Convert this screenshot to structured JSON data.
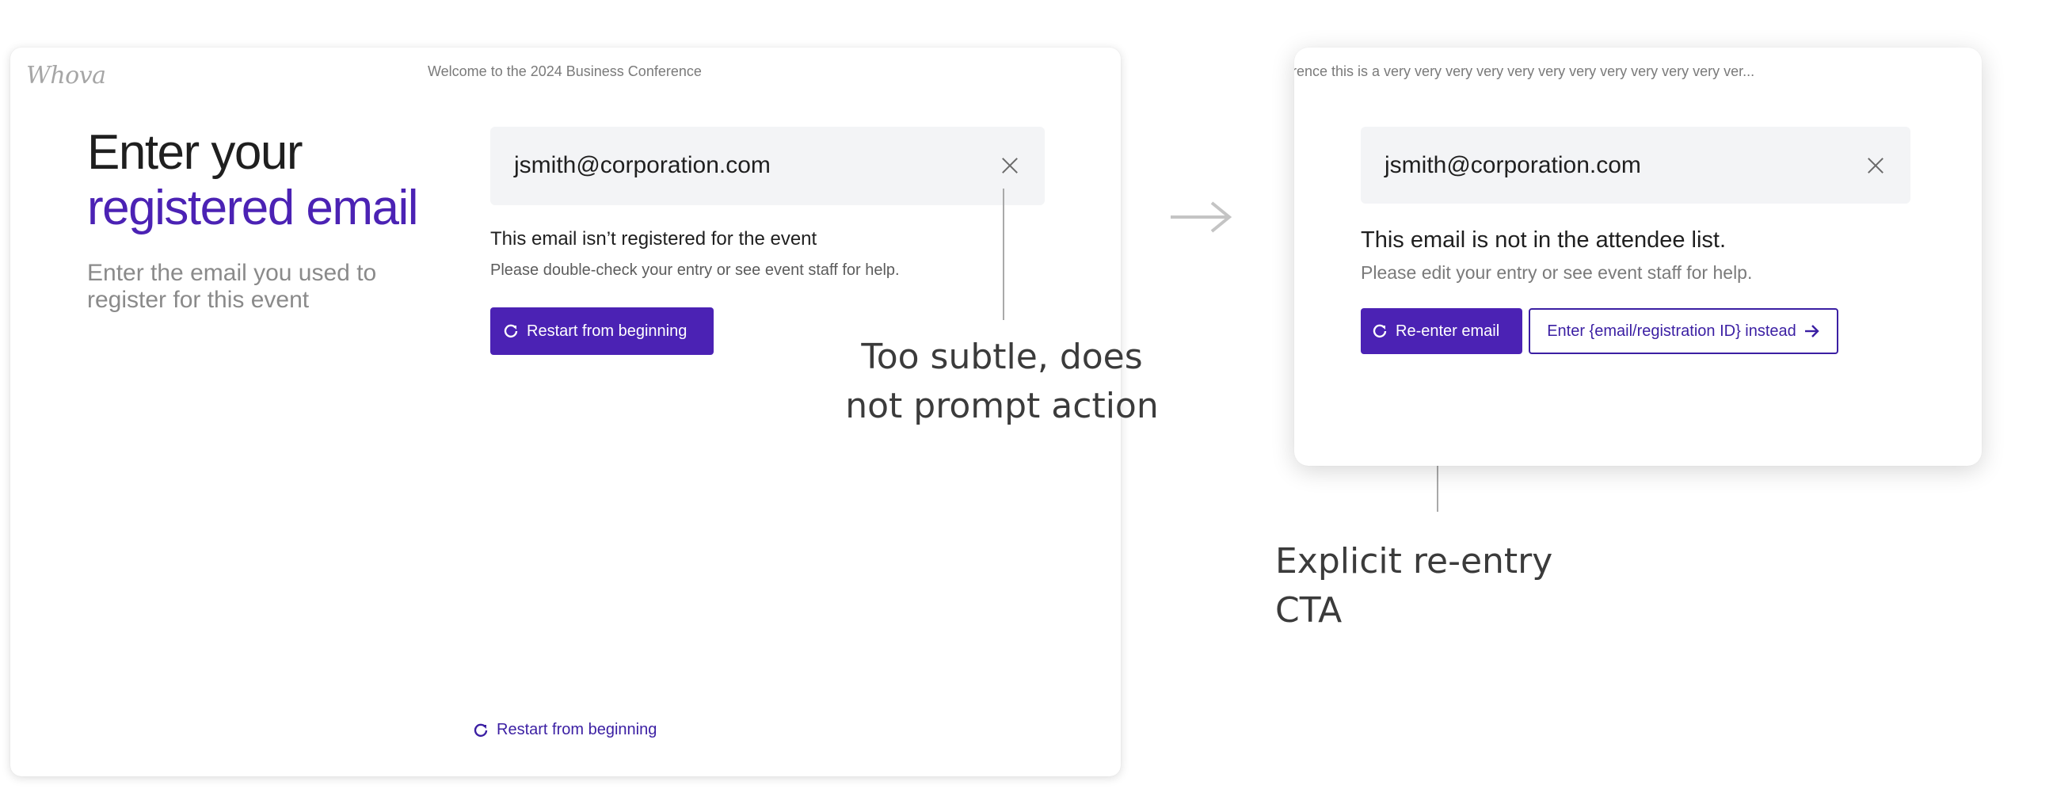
{
  "left_panel": {
    "logo": "Whova",
    "top_title": "Welcome to the 2024 Business Conference",
    "heading_line1": "Enter your",
    "heading_line2": "registered email",
    "subheading": "Enter the email you used to register for this event",
    "email_value": "jsmith@corporation.com",
    "error_title": "This email isn’t registered for the event",
    "error_body": "Please double-check your entry or see event staff for help.",
    "primary_button": "Restart from beginning",
    "footer_link": "Restart from beginning"
  },
  "right_panel": {
    "top_title": "rence this is a very very very very very very very very very very very ver...",
    "email_value": "jsmith@corporation.com",
    "error_title": "This email is not in the attendee list.",
    "error_body": "Please edit your entry or see event staff for help.",
    "primary_button": "Re-enter email",
    "secondary_button": "Enter {email/registration ID} instead"
  },
  "annotations": {
    "left_line1": "Too subtle, does",
    "left_line2": "not prompt action",
    "right": "Explicit re-entry CTA"
  },
  "icons": {
    "clear": "close-icon",
    "refresh": "refresh-icon",
    "arrow": "arrow-right-icon",
    "transition": "transition-arrow-icon"
  },
  "colors": {
    "brand_purple": "#4b22b4",
    "link_purple": "#3b1fa3",
    "input_bg": "#f3f4f6"
  }
}
